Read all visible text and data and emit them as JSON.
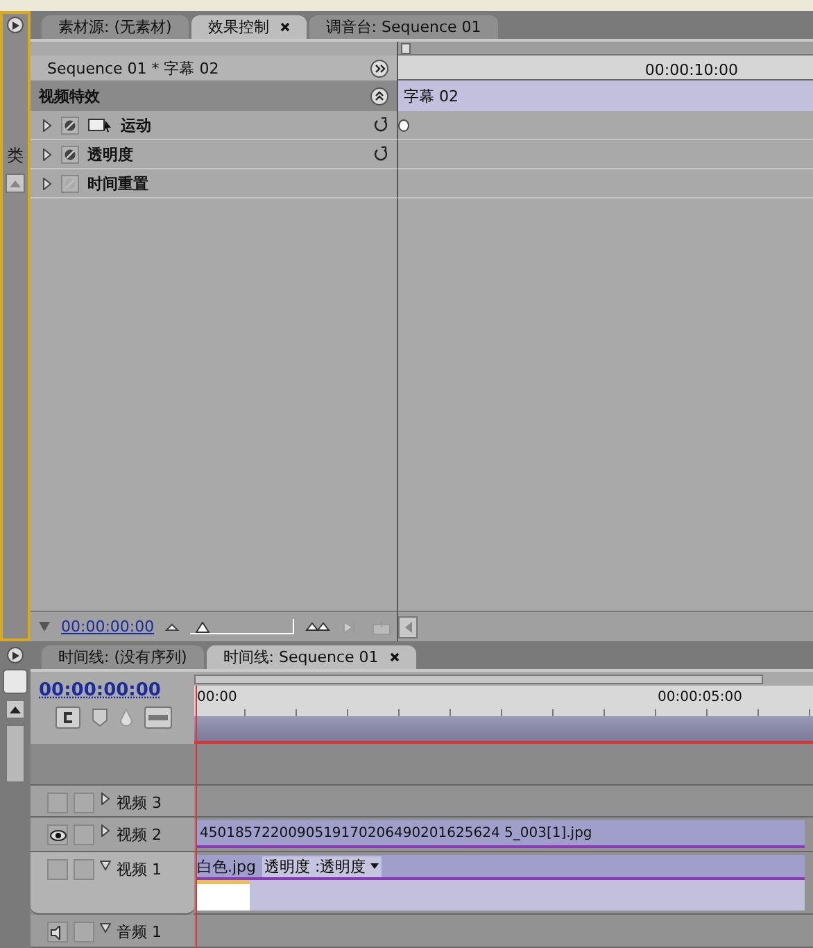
{
  "project_panel": {
    "label": "类"
  },
  "effect_controls": {
    "tabs": [
      {
        "label": "素材源: (无素材)",
        "selected": false,
        "closable": false
      },
      {
        "label": "效果控制",
        "selected": true,
        "closable": true
      },
      {
        "label": "调音台: Sequence 01",
        "selected": false,
        "closable": false
      }
    ],
    "sequence_title": "Sequence 01 * 字幕 02",
    "section": "视频特效",
    "effects": [
      {
        "name": "运动",
        "kind": "motion",
        "enabled": true,
        "expanded": false
      },
      {
        "name": "透明度",
        "kind": "plain",
        "enabled": true,
        "expanded": false
      },
      {
        "name": "时间重置",
        "kind": "plain",
        "enabled": false,
        "expanded": false
      }
    ],
    "ruler_time": "00:00:10:00",
    "clip": "字幕 02",
    "timecode": "00:00:00:00",
    "zoom_slider": {
      "level": 0.12
    }
  },
  "timeline": {
    "tabs": [
      {
        "label": "时间线: (没有序列)",
        "selected": false,
        "closable": false
      },
      {
        "label": "时间线: Sequence 01",
        "selected": true,
        "closable": true
      }
    ],
    "timecode": "00:00:00:00",
    "ruler": [
      "00:00",
      "00:00:05:00"
    ],
    "tracks": [
      {
        "name": "视频 3",
        "kind": "video",
        "visible": false,
        "expanded": false
      },
      {
        "name": "视频 2",
        "kind": "video",
        "visible": true,
        "expanded": false,
        "clips": [
          {
            "name": "4501857220090519170206490201625624 5_003[1].jpg"
          }
        ]
      },
      {
        "name": "视频 1",
        "kind": "video",
        "visible": false,
        "expanded": true,
        "clips": [
          {
            "name": "白色.jpg",
            "property": "透明度 :透明度"
          }
        ]
      },
      {
        "name": "音频 1",
        "kind": "audio",
        "visible": false,
        "expanded": true
      }
    ]
  }
}
